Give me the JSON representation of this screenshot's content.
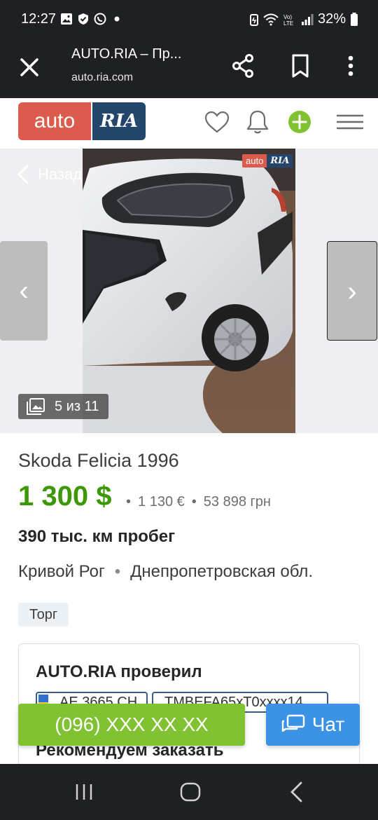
{
  "status_bar": {
    "time": "12:27",
    "battery": "32%",
    "left_icons": [
      "gallery-icon",
      "shield-icon",
      "viber-icon",
      "dot-icon"
    ],
    "right_icons": [
      "battery-saver-icon",
      "wifi-icon",
      "volte-icon",
      "signal-icon",
      "battery-icon"
    ]
  },
  "browser": {
    "title": "AUTO.RIA – Пр...",
    "url": "auto.ria.com"
  },
  "site_header": {
    "logo_auto": "auto",
    "logo_ria": "RIA"
  },
  "gallery": {
    "back_label": "Назад",
    "counter": "5 из 11",
    "prev_label": "‹",
    "next_label": "›",
    "watermark_auto": "auto",
    "watermark_ria": "RIA"
  },
  "listing": {
    "title": "Skoda Felicia 1996",
    "price_usd": "1 300 $",
    "price_eur": "1 130 €",
    "price_uah": "53 898 грн",
    "mileage": "390 тыс. км пробег",
    "city": "Кривой Рог",
    "region": "Днепропетровская обл.",
    "tag": "Торг"
  },
  "check_card": {
    "title": "AUTO.RIA проверил",
    "plate": "АЕ 3665 СН",
    "vin": "TMBEFA65xT0xxxx14",
    "recommend": "Рекомендуем заказать"
  },
  "actions": {
    "phone": "(096) XXX XX XX",
    "chat": "Чат"
  },
  "colors": {
    "system_bar": "#1f2023",
    "logo_red": "#db5c4c",
    "logo_blue": "#24466d",
    "price_green": "#3c9806",
    "call_green": "#80c231",
    "chat_blue": "#3c93e6"
  }
}
